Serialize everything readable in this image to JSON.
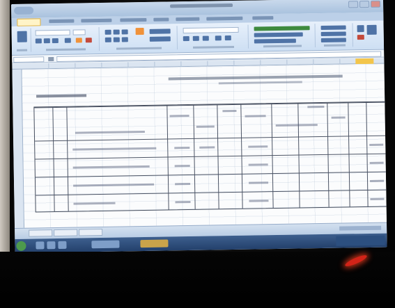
{
  "window": {
    "title": ""
  },
  "ribbon": {
    "tabs": [
      "",
      "",
      "",
      "",
      "",
      "",
      "",
      ""
    ],
    "active_tab": 0
  },
  "formula_bar": {
    "name_box": "",
    "formula": ""
  },
  "sheet": {
    "title": "",
    "subtitle": "",
    "header_label": "",
    "table": {
      "column_headers": [
        "",
        "",
        "",
        "",
        "",
        "",
        "",
        "",
        "",
        "",
        "",
        ""
      ],
      "rows": [
        [
          "",
          "",
          "",
          "",
          "",
          "",
          "",
          "",
          "",
          "",
          "",
          ""
        ],
        [
          "",
          "",
          "",
          "",
          "",
          "",
          "",
          "",
          "",
          "",
          "",
          ""
        ],
        [
          "",
          "",
          "",
          "",
          "",
          "",
          "",
          "",
          "",
          "",
          "",
          ""
        ],
        [
          "",
          "",
          "",
          "",
          "",
          "",
          "",
          "",
          "",
          "",
          "",
          ""
        ]
      ]
    }
  },
  "sheet_tabs": [
    "",
    "",
    ""
  ],
  "status": {
    "zoom": ""
  },
  "colors": {
    "ribbon": "#cddff3",
    "selected_column": "#f3c54b",
    "status_led": "#d22318"
  }
}
